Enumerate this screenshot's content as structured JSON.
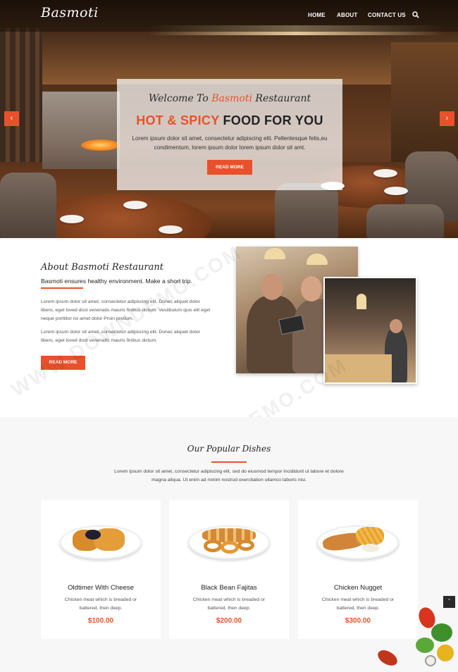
{
  "brand": {
    "logo": "Basmoti",
    "accent_color": "#e8512b"
  },
  "nav": {
    "items": [
      "HOME",
      "ABOUT",
      "CONTACT US"
    ],
    "search_icon": "search-icon"
  },
  "hero": {
    "welcome_prefix": "Welcome To ",
    "welcome_brand": "Basmoti",
    "welcome_suffix": " Restaurant",
    "title_accent": "HOT & SPICY",
    "title_rest": " FOOD FOR YOU",
    "text": "Lorem ipsum dolor sit amet, consectetur adipiscing elit. Pellentesque felis,eu condimentum, lorem ipsum dolor lorem ipsum dolor sit amt.",
    "button": "READ MORE",
    "prev_icon": "chevron-left-icon",
    "next_icon": "chevron-right-icon"
  },
  "about": {
    "heading": "About Basmoti Restaurant",
    "subheading": "Basmoti ensures healthy environment. Make a short trip.",
    "paragraphs": [
      "Lorem ipsum dolor sit amet, consectetur adipiscing elit. Donec aliquet dolor libero, eget loved dost venenatis mauris finibus dictum. Vestibulum quis elit eget neque porttitor no amet dolor Proin pretium.",
      "Lorem ipsum dolor sit amet, consectetur adipiscing elit. Donec aliquet dolor libero, eget loved dost venenatis mauris finibus dictum."
    ],
    "button": "READ MORE"
  },
  "dishes": {
    "heading": "Our Popular Dishes",
    "intro": "Lorem ipsum dolor sit amet, consectetur adipiscing elit, sed do eiusmod tempor incididunt ut labore et dolore magna aliqua. Ut enim ad minim nostrud exercitation ullamco laboris nisi.",
    "items": [
      {
        "name": "Oldtimer With Cheese",
        "description": "Chicken meat which is breaded or battered, then deep.",
        "price": "$100.00"
      },
      {
        "name": "Black Bean Fajitas",
        "description": "Chicken meat which is breaded or battered, then deep.",
        "price": "$200.00"
      },
      {
        "name": "Chicken Nugget",
        "description": "Chicken meat which is breaded or battered, then deep.",
        "price": "$300.00"
      }
    ]
  },
  "back_to_top_icon": "chevron-up-icon",
  "watermark": "WWW.DOWNDEMO.COM"
}
